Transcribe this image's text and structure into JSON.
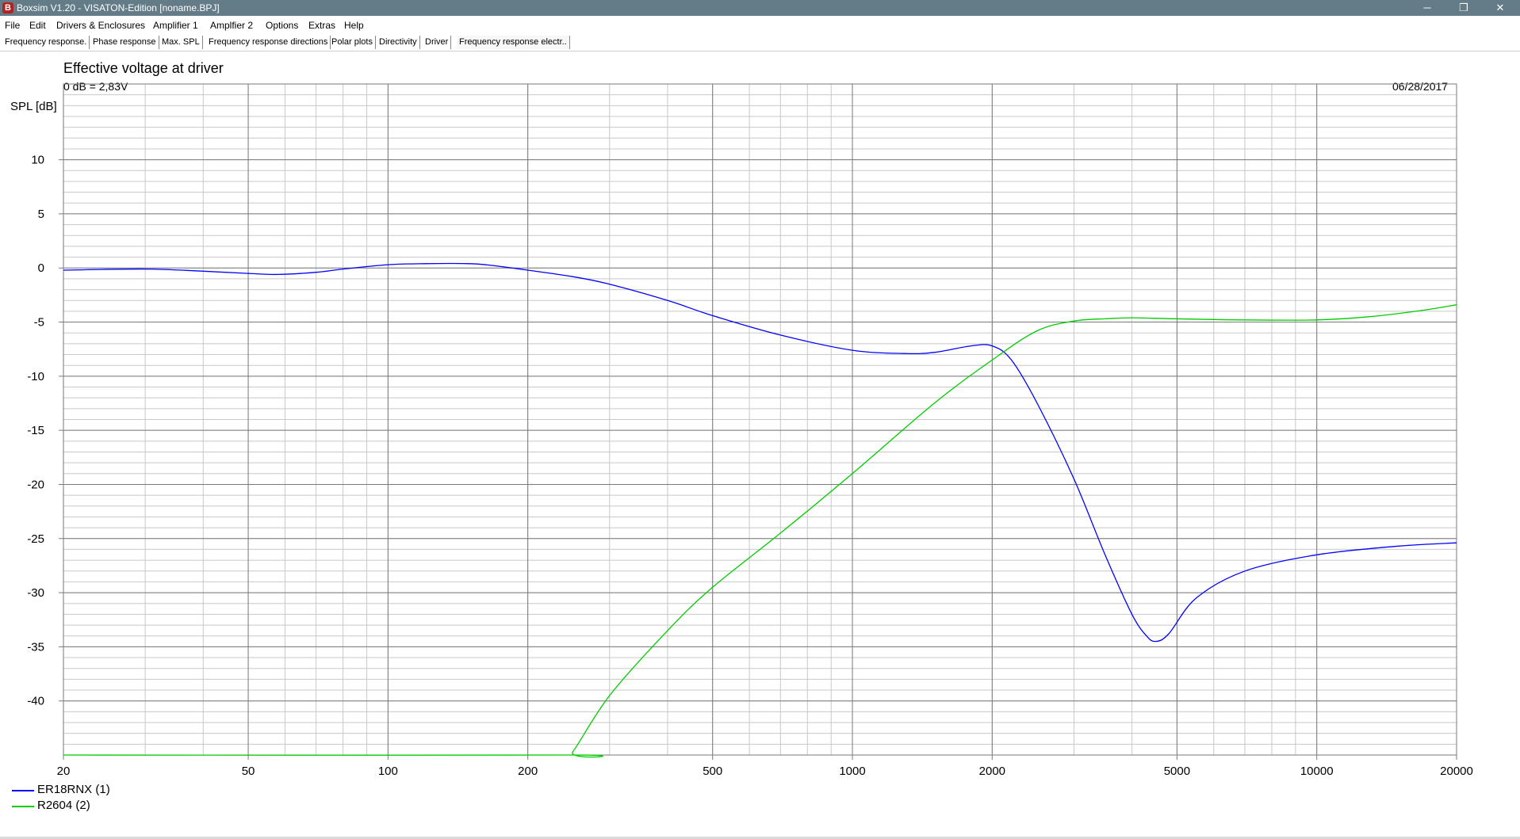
{
  "window": {
    "title": "Boxsim V1.20 - VISATON-Edition [noname.BPJ]",
    "controls": {
      "minimize": "─",
      "maximize": "❐",
      "close": "✕"
    }
  },
  "menu": {
    "items": [
      "File",
      "Edit",
      "Drivers & Enclosures",
      "Amplifier 1",
      "Amplfier 2",
      "Options",
      "Extras",
      "Help"
    ]
  },
  "tabs": {
    "items": [
      "Frequency response.",
      "Phase response",
      "Max. SPL",
      "Frequency response directions",
      "Polar plots",
      "Directivity",
      "Driver",
      "Frequency response electr.."
    ],
    "active_index": 7
  },
  "chart": {
    "title": "Effective voltage at driver",
    "subtitle": "0 dB = 2,83V",
    "date": "06/28/2017",
    "ylabel": "SPL [dB]"
  },
  "chart_data": {
    "type": "line",
    "x_scale": "log",
    "xlim": [
      20,
      20000
    ],
    "ylim": [
      -45,
      17
    ],
    "x_ticks": [
      20,
      50,
      100,
      200,
      500,
      1000,
      2000,
      5000,
      10000,
      20000
    ],
    "y_ticks": [
      10,
      5,
      0,
      -5,
      -10,
      -15,
      -20,
      -25,
      -30,
      -35,
      -40
    ],
    "grid": true,
    "legend_position": "bottom-left",
    "series": [
      {
        "name": "ER18RNX (1)",
        "color": "#0000ff",
        "points": [
          [
            20,
            -0.2
          ],
          [
            30,
            -0.1
          ],
          [
            40,
            -0.3
          ],
          [
            50,
            -0.5
          ],
          [
            58,
            -0.6
          ],
          [
            70,
            -0.4
          ],
          [
            80,
            -0.1
          ],
          [
            100,
            0.3
          ],
          [
            120,
            0.4
          ],
          [
            150,
            0.4
          ],
          [
            170,
            0.2
          ],
          [
            200,
            -0.2
          ],
          [
            250,
            -0.8
          ],
          [
            300,
            -1.5
          ],
          [
            400,
            -3.0
          ],
          [
            500,
            -4.4
          ],
          [
            700,
            -6.2
          ],
          [
            1000,
            -7.6
          ],
          [
            1300,
            -7.9
          ],
          [
            1500,
            -7.8
          ],
          [
            1800,
            -7.2
          ],
          [
            2000,
            -7.2
          ],
          [
            2200,
            -8.5
          ],
          [
            2500,
            -12.5
          ],
          [
            3000,
            -19.5
          ],
          [
            3500,
            -26.5
          ],
          [
            4000,
            -32.0
          ],
          [
            4300,
            -34.0
          ],
          [
            4500,
            -34.5
          ],
          [
            4800,
            -33.8
          ],
          [
            5500,
            -30.5
          ],
          [
            7000,
            -28.0
          ],
          [
            10000,
            -26.5
          ],
          [
            15000,
            -25.7
          ],
          [
            20000,
            -25.4
          ]
        ]
      },
      {
        "name": "R2604 (2)",
        "color": "#00cc00",
        "points": [
          [
            20,
            -45.0
          ],
          [
            240,
            -45.0
          ],
          [
            250,
            -44.7
          ],
          [
            300,
            -39.5
          ],
          [
            400,
            -33.5
          ],
          [
            500,
            -29.5
          ],
          [
            700,
            -24.5
          ],
          [
            1000,
            -19.0
          ],
          [
            1500,
            -12.5
          ],
          [
            2000,
            -8.5
          ],
          [
            2500,
            -5.8
          ],
          [
            3000,
            -4.9
          ],
          [
            3500,
            -4.7
          ],
          [
            4000,
            -4.6
          ],
          [
            5000,
            -4.7
          ],
          [
            7000,
            -4.8
          ],
          [
            10000,
            -4.8
          ],
          [
            13000,
            -4.5
          ],
          [
            17000,
            -3.9
          ],
          [
            20000,
            -3.4
          ]
        ]
      }
    ]
  }
}
